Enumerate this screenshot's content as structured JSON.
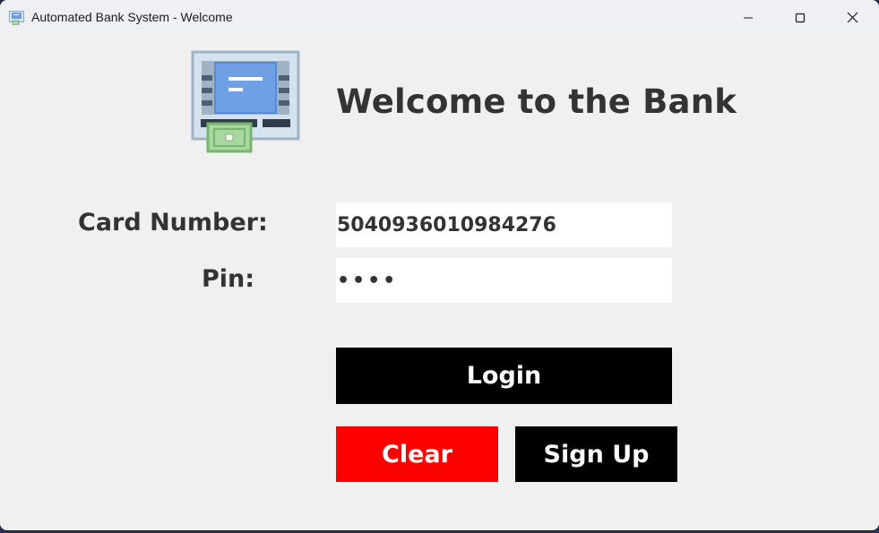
{
  "window": {
    "title": "Automated Bank System - Welcome",
    "app_icon": "atm-machine-icon",
    "controls": {
      "minimize_icon": "minimize-icon",
      "maximize_icon": "maximize-icon",
      "close_icon": "close-icon"
    }
  },
  "header": {
    "logo_icon": "atm-machine-icon",
    "title": "Welcome to the Bank"
  },
  "form": {
    "card_label": "Card Number:",
    "card_value": "504093601098427​6",
    "pin_label": "Pin:",
    "pin_value": "••••"
  },
  "buttons": {
    "login": "Login",
    "clear": "Clear",
    "signup": "Sign Up"
  },
  "colors": {
    "background": "#f0f0f0",
    "text": "#333333",
    "login_bg": "#000000",
    "clear_bg": "#ff0000",
    "signup_bg": "#000000",
    "button_text": "#ffffff"
  }
}
